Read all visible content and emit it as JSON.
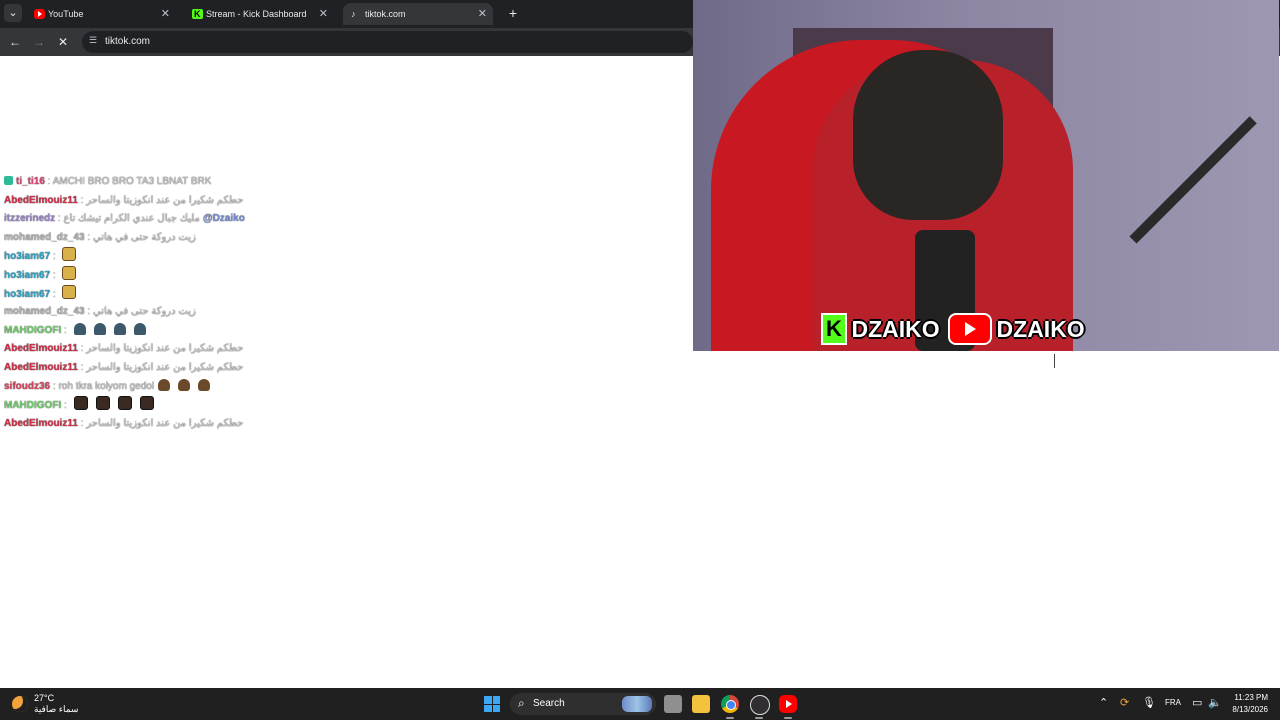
{
  "browser": {
    "tabs": [
      {
        "title": "YouTube",
        "icon": "youtube-icon"
      },
      {
        "title": "Stream - Kick Dashboard",
        "icon": "kick-icon"
      },
      {
        "title": "tiktok.com",
        "icon": "tiktok-icon"
      }
    ],
    "active_tab": 2,
    "url": "tiktok.com"
  },
  "chat": {
    "messages": [
      {
        "user": "ti_ti16",
        "user_color": "#d84a74",
        "badge": true,
        "text": "AMCHI BRO BRO TA3 LBNAT BRK"
      },
      {
        "user": "AbedElmouiz11",
        "user_color": "#d0324b",
        "text": "حطكم شكيرا من عند انكوزيتا والساحر"
      },
      {
        "user": "itzzerinedz",
        "user_color": "#9b86c9",
        "text": "مليك جبال عندي الكرام تيشك تاع",
        "mention": "@Dzaiko"
      },
      {
        "user": "mohamed_dz_43",
        "user_color": "#b5b5b5",
        "text": "زيت دروكة حتى في هاتي"
      },
      {
        "user": "ho3iam67",
        "user_color": "#2aa7c9",
        "emotes": [
          "scroll"
        ]
      },
      {
        "user": "ho3iam67",
        "user_color": "#2aa7c9",
        "emotes": [
          "scroll"
        ]
      },
      {
        "user": "ho3iam67",
        "user_color": "#2aa7c9",
        "emotes": [
          "scroll"
        ]
      },
      {
        "user": "mohamed_dz_43",
        "user_color": "#b5b5b5",
        "text": "زيت دروكة حتى في هاتي"
      },
      {
        "user": "MAHDIGOFI",
        "user_color": "#6fd16a",
        "emotes": [
          "blob",
          "blob",
          "blob",
          "blob"
        ]
      },
      {
        "user": "AbedElmouiz11",
        "user_color": "#d0324b",
        "text": "حطكم شكيرا من عند انكوزيتا والساحر"
      },
      {
        "user": "AbedElmouiz11",
        "user_color": "#d0324b",
        "text": "حطكم شكيرا من عند انكوزيتا والساحر"
      },
      {
        "user": "sifoudz36",
        "user_color": "#d8465f",
        "text": "roh tkra kolyom gedol",
        "emotes": [
          "cat",
          "cat",
          "cat"
        ]
      },
      {
        "user": "MAHDIGOFI",
        "user_color": "#6fd16a",
        "emotes": [
          "face",
          "face",
          "face",
          "face"
        ]
      },
      {
        "user": "AbedElmouiz11",
        "user_color": "#d0324b",
        "text": "حطكم شكيرا من عند انكوزيتا والساحر"
      }
    ]
  },
  "video": {
    "brand_kick": "DZAIKO",
    "brand_youtube": "DZAIKO",
    "kick_letter": "K"
  },
  "taskbar": {
    "weather_temp": "27°C",
    "weather_desc": "سماء صافية",
    "search_label": "Search",
    "language": "FRA",
    "time": "11:23 PM",
    "date": "8/13/2026"
  }
}
